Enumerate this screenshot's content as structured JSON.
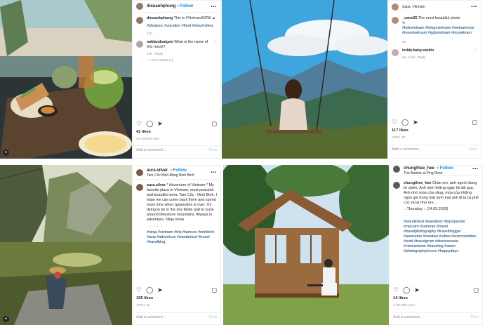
{
  "posts": [
    {
      "header": {
        "username": "dieuanhphung",
        "follow": "• Follow"
      },
      "caption": {
        "username": "dieuanhphung",
        "text": "This is #VietnamNOW",
        "hashtags": "#phuquoc #vacation #food #beachvibes",
        "time": "12h"
      },
      "comment": {
        "username": "oaklandsaigon",
        "text": "What is the name of this resort?",
        "time": "12h",
        "reply_label": "Reply",
        "view_replies": "View replies (1)"
      },
      "likes": "42 likes",
      "date": "12 HOURS AGO",
      "add_comment": "Add a comment...",
      "post_button": "Post"
    },
    {
      "header": {
        "username": "_vann25",
        "location": "Sapa, Vietnam"
      },
      "caption": {
        "username": "_vann25",
        "text": "The most beautiful photo",
        "hashtags": "#fallsvietnam #lofsgovietnam #vietnamnow #travelvietnam #igdyvietnam #myvietnam",
        "time": "2w"
      },
      "comment": {
        "username": "teddy.baby.studio",
        "text": "",
        "time": "1w",
        "likes": "1 like",
        "reply_label": "Reply"
      },
      "likes": "117 likes",
      "date": "APRIL 28",
      "add_comment": "Add a comment...",
      "post_button": "Post"
    },
    {
      "header": {
        "username": "aura.silver",
        "follow": "• Follow",
        "location": "Tam Cốc Bích Động Ninh Bình"
      },
      "caption": {
        "username": "aura.silver",
        "text": "* Adventure of Vietnam * My favorite place in Vietnam, most peaceful and beautiful area, Tam Cốc - Ninh Binh. I hope we can come back there and spend more time when quarantine is over. I'm dying to be in the rice fields and to cycle around limestone mountains. Always in adventure, Ninja Irena",
        "dots": ". . . . .",
        "hashtags": "#ninja #vietnam #trip #tamcoc #ninhbinh #asia #adventure #wanderlust #travel #travelblog"
      },
      "likes": "155 likes",
      "date": "APRIL 11",
      "add_comment": "Add a comment...",
      "post_button": "Post"
    },
    {
      "header": {
        "username": "chungthee_hee",
        "follow": "• Follow",
        "location": "The Barista at Ping River"
      },
      "caption": {
        "username": "chungthee_hee",
        "text": "Chào em, anh người đang từ chiều. Anh nhớ những ngày hè đã qua. Anh nhớ mùa của năng, mùa của những ngọn gió trong mát sớm mai anh lê la cà phê cóc và lại nhớ em...",
        "note": "...Thursday :. (14.05.2020)",
        "dots": ". . . . .",
        "hashtags": "#wanderlust #wanderer #backpacker #vsocam #summer #travel #travelphotography #travelblogger #awesome #creative #vibes #summervibes #ootd #travelgram #discoverasia #vietnamnow #traveling #asian #photographylovers #happydays"
      },
      "likes": "14 likes",
      "date": "3 HOURS AGO",
      "add_comment": "Add a comment...",
      "post_button": "Post"
    }
  ],
  "icons": [
    "heart-icon",
    "comment-icon",
    "share-icon",
    "bookmark-icon",
    "more-icon",
    "user-tag-icon"
  ],
  "colors": {
    "link": "#0095f6",
    "hashtag": "#00376b",
    "muted": "#8e8e8e",
    "border": "#efefef"
  }
}
